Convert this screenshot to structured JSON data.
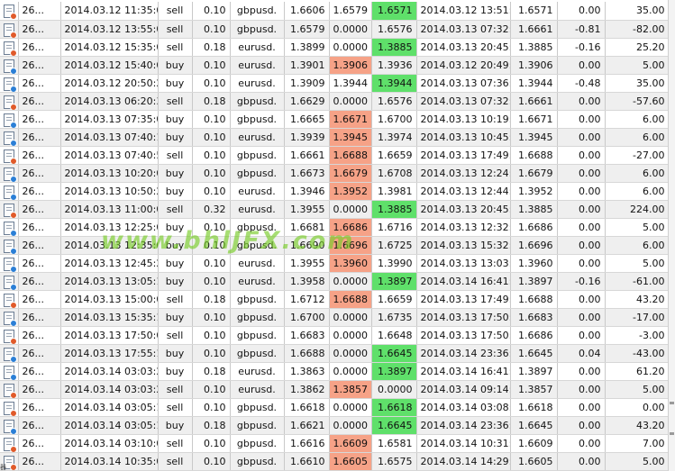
{
  "watermark": "www.bhlJFX.com",
  "corner_label": "器",
  "rows": [
    {
      "id": "26...",
      "open_time": "2014.03.12 11:35:05",
      "type": "sell",
      "size": "0.10",
      "symbol": "gbpusd.",
      "open_price": "1.6606",
      "sl": "1.6579",
      "tp": "1.6571",
      "close_time": "2014.03.12 13:51:30",
      "close_price": "1.6571",
      "swap": "0.00",
      "profit": "35.00",
      "hl": "tp-green"
    },
    {
      "id": "26...",
      "open_time": "2014.03.12 13:55:02",
      "type": "sell",
      "size": "0.10",
      "symbol": "gbpusd.",
      "open_price": "1.6579",
      "sl": "0.0000",
      "tp": "1.6576",
      "close_time": "2014.03.13 07:32:07",
      "close_price": "1.6661",
      "swap": "-0.81",
      "profit": "-82.00",
      "hl": ""
    },
    {
      "id": "26...",
      "open_time": "2014.03.12 15:35:08",
      "type": "sell",
      "size": "0.18",
      "symbol": "eurusd.",
      "open_price": "1.3899",
      "sl": "0.0000",
      "tp": "1.3885",
      "close_time": "2014.03.13 20:45:40",
      "close_price": "1.3885",
      "swap": "-0.16",
      "profit": "25.20",
      "hl": "tp-green"
    },
    {
      "id": "26...",
      "open_time": "2014.03.12 15:40:08",
      "type": "buy",
      "size": "0.10",
      "symbol": "eurusd.",
      "open_price": "1.3901",
      "sl": "1.3906",
      "tp": "1.3936",
      "close_time": "2014.03.12 20:49:22",
      "close_price": "1.3906",
      "swap": "0.00",
      "profit": "5.00",
      "hl": "sl-red"
    },
    {
      "id": "26...",
      "open_time": "2014.03.12 20:50:29",
      "type": "buy",
      "size": "0.10",
      "symbol": "eurusd.",
      "open_price": "1.3909",
      "sl": "1.3944",
      "tp": "1.3944",
      "close_time": "2014.03.13 07:36:14",
      "close_price": "1.3944",
      "swap": "-0.48",
      "profit": "35.00",
      "hl": "tp-green"
    },
    {
      "id": "26...",
      "open_time": "2014.03.13 06:20:39",
      "type": "sell",
      "size": "0.18",
      "symbol": "gbpusd.",
      "open_price": "1.6629",
      "sl": "0.0000",
      "tp": "1.6576",
      "close_time": "2014.03.13 07:32:07",
      "close_price": "1.6661",
      "swap": "0.00",
      "profit": "-57.60",
      "hl": ""
    },
    {
      "id": "26...",
      "open_time": "2014.03.13 07:35:00",
      "type": "buy",
      "size": "0.10",
      "symbol": "gbpusd.",
      "open_price": "1.6665",
      "sl": "1.6671",
      "tp": "1.6700",
      "close_time": "2014.03.13 10:19:36",
      "close_price": "1.6671",
      "swap": "0.00",
      "profit": "6.00",
      "hl": "sl-red"
    },
    {
      "id": "26...",
      "open_time": "2014.03.13 07:40:13",
      "type": "buy",
      "size": "0.10",
      "symbol": "eurusd.",
      "open_price": "1.3939",
      "sl": "1.3945",
      "tp": "1.3974",
      "close_time": "2014.03.13 10:45:51",
      "close_price": "1.3945",
      "swap": "0.00",
      "profit": "6.00",
      "hl": "sl-red"
    },
    {
      "id": "26...",
      "open_time": "2014.03.13 07:40:51",
      "type": "sell",
      "size": "0.10",
      "symbol": "gbpusd.",
      "open_price": "1.6661",
      "sl": "1.6688",
      "tp": "1.6659",
      "close_time": "2014.03.13 17:49:57",
      "close_price": "1.6688",
      "swap": "0.00",
      "profit": "-27.00",
      "hl": "sl-red"
    },
    {
      "id": "26...",
      "open_time": "2014.03.13 10:20:02",
      "type": "buy",
      "size": "0.10",
      "symbol": "gbpusd.",
      "open_price": "1.6673",
      "sl": "1.6679",
      "tp": "1.6708",
      "close_time": "2014.03.13 12:24:05",
      "close_price": "1.6679",
      "swap": "0.00",
      "profit": "6.00",
      "hl": "sl-red"
    },
    {
      "id": "26...",
      "open_time": "2014.03.13 10:50:23",
      "type": "buy",
      "size": "0.10",
      "symbol": "eurusd.",
      "open_price": "1.3946",
      "sl": "1.3952",
      "tp": "1.3981",
      "close_time": "2014.03.13 12:44:17",
      "close_price": "1.3952",
      "swap": "0.00",
      "profit": "6.00",
      "hl": "sl-red"
    },
    {
      "id": "26...",
      "open_time": "2014.03.13 11:00:02",
      "type": "sell",
      "size": "0.32",
      "symbol": "eurusd.",
      "open_price": "1.3955",
      "sl": "0.0000",
      "tp": "1.3885",
      "close_time": "2014.03.13 20:45:40",
      "close_price": "1.3885",
      "swap": "0.00",
      "profit": "224.00",
      "hl": "tp-green"
    },
    {
      "id": "26...",
      "open_time": "2014.03.13 12:25:03",
      "type": "buy",
      "size": "0.10",
      "symbol": "gbpusd.",
      "open_price": "1.6681",
      "sl": "1.6686",
      "tp": "1.6716",
      "close_time": "2014.03.13 12:32:57",
      "close_price": "1.6686",
      "swap": "0.00",
      "profit": "5.00",
      "hl": "sl-red"
    },
    {
      "id": "26...",
      "open_time": "2014.03.13 12:35:03",
      "type": "buy",
      "size": "0.10",
      "symbol": "gbpusd.",
      "open_price": "1.6690",
      "sl": "1.6696",
      "tp": "1.6725",
      "close_time": "2014.03.13 15:32:00",
      "close_price": "1.6696",
      "swap": "0.00",
      "profit": "6.00",
      "hl": "sl-red"
    },
    {
      "id": "26...",
      "open_time": "2014.03.13 12:45:23",
      "type": "buy",
      "size": "0.10",
      "symbol": "eurusd.",
      "open_price": "1.3955",
      "sl": "1.3960",
      "tp": "1.3990",
      "close_time": "2014.03.13 13:03:05",
      "close_price": "1.3960",
      "swap": "0.00",
      "profit": "5.00",
      "hl": "sl-red"
    },
    {
      "id": "26...",
      "open_time": "2014.03.13 13:05:19",
      "type": "buy",
      "size": "0.10",
      "symbol": "eurusd.",
      "open_price": "1.3958",
      "sl": "0.0000",
      "tp": "1.3897",
      "close_time": "2014.03.14 16:41:11",
      "close_price": "1.3897",
      "swap": "-0.16",
      "profit": "-61.00",
      "hl": "tp-green"
    },
    {
      "id": "26...",
      "open_time": "2014.03.13 15:00:04",
      "type": "sell",
      "size": "0.18",
      "symbol": "gbpusd.",
      "open_price": "1.6712",
      "sl": "1.6688",
      "tp": "1.6659",
      "close_time": "2014.03.13 17:49:57",
      "close_price": "1.6688",
      "swap": "0.00",
      "profit": "43.20",
      "hl": "sl-red"
    },
    {
      "id": "26...",
      "open_time": "2014.03.13 15:35:10",
      "type": "buy",
      "size": "0.10",
      "symbol": "gbpusd.",
      "open_price": "1.6700",
      "sl": "0.0000",
      "tp": "1.6735",
      "close_time": "2014.03.13 17:50:03",
      "close_price": "1.6683",
      "swap": "0.00",
      "profit": "-17.00",
      "hl": ""
    },
    {
      "id": "26...",
      "open_time": "2014.03.13 17:50:02",
      "type": "sell",
      "size": "0.10",
      "symbol": "gbpusd.",
      "open_price": "1.6683",
      "sl": "0.0000",
      "tp": "1.6648",
      "close_time": "2014.03.13 17:50:03",
      "close_price": "1.6686",
      "swap": "0.00",
      "profit": "-3.00",
      "hl": ""
    },
    {
      "id": "26...",
      "open_time": "2014.03.13 17:55:10",
      "type": "buy",
      "size": "0.10",
      "symbol": "gbpusd.",
      "open_price": "1.6688",
      "sl": "0.0000",
      "tp": "1.6645",
      "close_time": "2014.03.14 23:36:59",
      "close_price": "1.6645",
      "swap": "0.04",
      "profit": "-43.00",
      "hl": "tp-green"
    },
    {
      "id": "26...",
      "open_time": "2014.03.14 03:03:22",
      "type": "buy",
      "size": "0.18",
      "symbol": "eurusd.",
      "open_price": "1.3863",
      "sl": "0.0000",
      "tp": "1.3897",
      "close_time": "2014.03.14 16:41:11",
      "close_price": "1.3897",
      "swap": "0.00",
      "profit": "61.20",
      "hl": "tp-green"
    },
    {
      "id": "26...",
      "open_time": "2014.03.14 03:03:22",
      "type": "sell",
      "size": "0.10",
      "symbol": "eurusd.",
      "open_price": "1.3862",
      "sl": "1.3857",
      "tp": "0.0000",
      "close_time": "2014.03.14 09:14:52",
      "close_price": "1.3857",
      "swap": "0.00",
      "profit": "5.00",
      "hl": "sl-red"
    },
    {
      "id": "26...",
      "open_time": "2014.03.14 03:05:15",
      "type": "sell",
      "size": "0.10",
      "symbol": "gbpusd.",
      "open_price": "1.6618",
      "sl": "0.0000",
      "tp": "1.6618",
      "close_time": "2014.03.14 03:08:46",
      "close_price": "1.6618",
      "swap": "0.00",
      "profit": "0.00",
      "hl": "tp-green"
    },
    {
      "id": "26...",
      "open_time": "2014.03.14 03:05:16",
      "type": "buy",
      "size": "0.18",
      "symbol": "gbpusd.",
      "open_price": "1.6621",
      "sl": "0.0000",
      "tp": "1.6645",
      "close_time": "2014.03.14 23:36:59",
      "close_price": "1.6645",
      "swap": "0.00",
      "profit": "43.20",
      "hl": "tp-green"
    },
    {
      "id": "26...",
      "open_time": "2014.03.14 03:10:02",
      "type": "sell",
      "size": "0.10",
      "symbol": "gbpusd.",
      "open_price": "1.6616",
      "sl": "1.6609",
      "tp": "1.6581",
      "close_time": "2014.03.14 10:31:00",
      "close_price": "1.6609",
      "swap": "0.00",
      "profit": "7.00",
      "hl": "sl-red"
    },
    {
      "id": "26...",
      "open_time": "2014.03.14 10:35:01",
      "type": "sell",
      "size": "0.10",
      "symbol": "gbpusd.",
      "open_price": "1.6610",
      "sl": "1.6605",
      "tp": "1.6575",
      "close_time": "2014.03.14 14:29:41",
      "close_price": "1.6605",
      "swap": "0.00",
      "profit": "5.00",
      "hl": "sl-red"
    }
  ],
  "colors": {
    "sl_highlight": "#f6a287",
    "tp_highlight": "#5fe06a",
    "sell_dot": "#e05a2a",
    "buy_dot": "#2b7fd6"
  }
}
